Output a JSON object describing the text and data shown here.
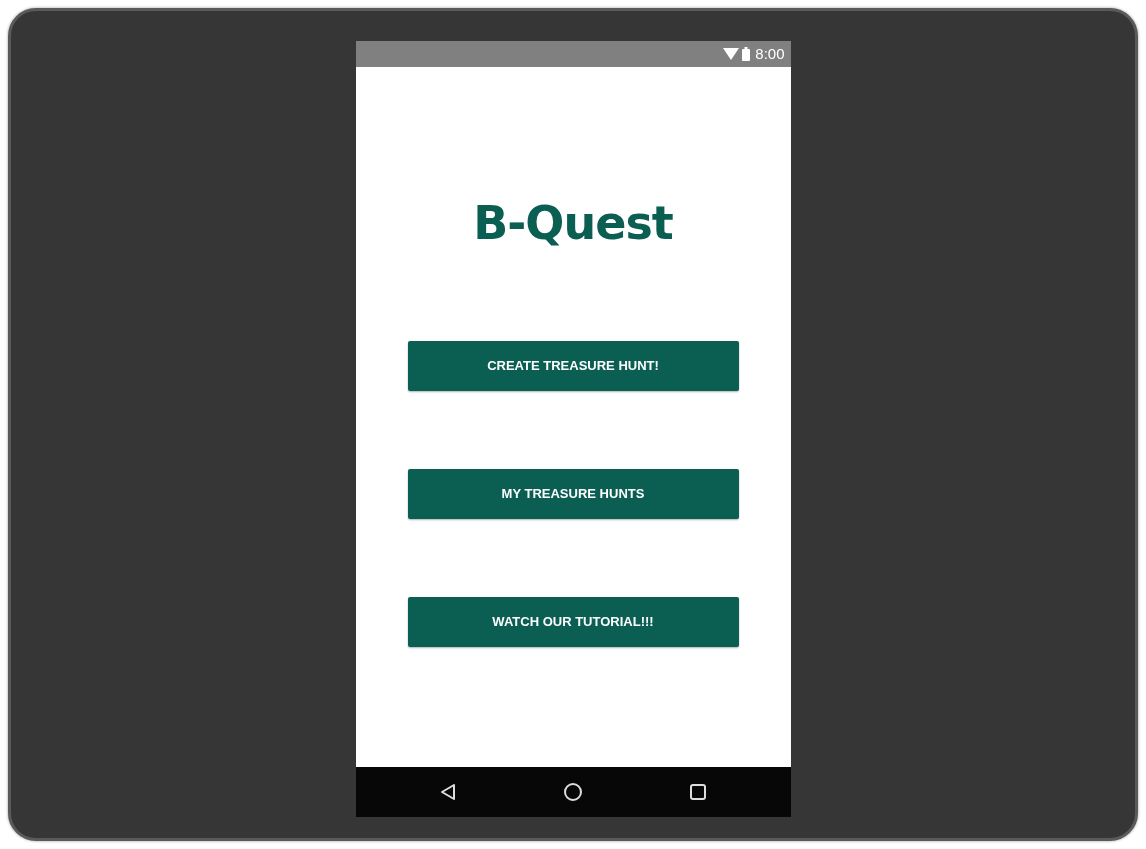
{
  "status_bar": {
    "time": "8:00"
  },
  "app": {
    "title": "B-Quest"
  },
  "buttons": [
    {
      "label": "CREATE TREASURE HUNT!"
    },
    {
      "label": "MY TREASURE HUNTS"
    },
    {
      "label": "WATCH OUR TUTORIAL!!!"
    }
  ]
}
